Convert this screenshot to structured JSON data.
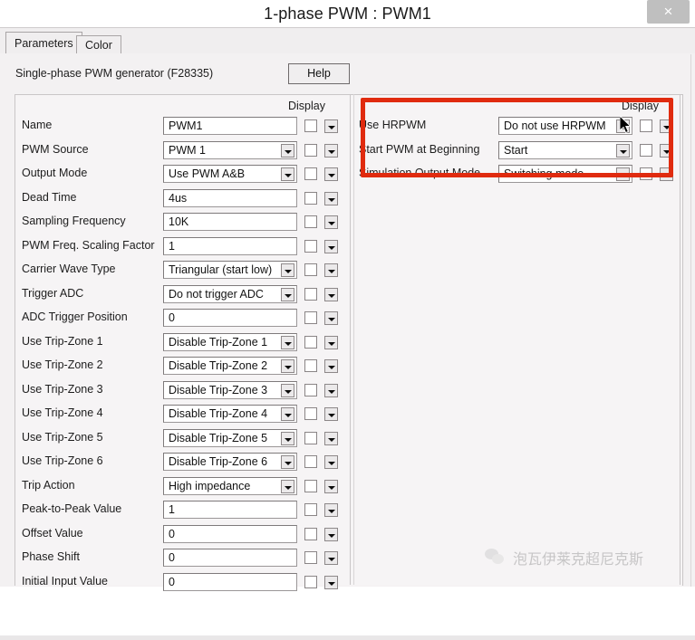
{
  "window": {
    "title": "1-phase PWM : PWM1",
    "close_label": "×"
  },
  "tabs": [
    {
      "label": "Parameters",
      "active": true
    },
    {
      "label": "Color",
      "active": false
    }
  ],
  "header": {
    "description": "Single-phase PWM generator (F28335)",
    "help_label": "Help"
  },
  "columns": {
    "left_display_header": "Display",
    "right_display_header": "Display"
  },
  "left_params": [
    {
      "label": "Name",
      "value": "PWM1",
      "type": "text"
    },
    {
      "label": "PWM Source",
      "value": "PWM 1",
      "type": "combo"
    },
    {
      "label": "Output Mode",
      "value": "Use PWM A&B",
      "type": "combo"
    },
    {
      "label": "Dead Time",
      "value": "4us",
      "type": "text"
    },
    {
      "label": "Sampling Frequency",
      "value": "10K",
      "type": "text"
    },
    {
      "label": "PWM Freq. Scaling Factor",
      "value": "1",
      "type": "text"
    },
    {
      "label": "Carrier Wave Type",
      "value": "Triangular (start low)",
      "type": "combo"
    },
    {
      "label": "Trigger ADC",
      "value": "Do not trigger ADC",
      "type": "combo"
    },
    {
      "label": "ADC Trigger Position",
      "value": "0",
      "type": "text"
    },
    {
      "label": "Use Trip-Zone 1",
      "value": "Disable Trip-Zone 1",
      "type": "combo"
    },
    {
      "label": "Use Trip-Zone 2",
      "value": "Disable Trip-Zone 2",
      "type": "combo"
    },
    {
      "label": "Use Trip-Zone 3",
      "value": "Disable Trip-Zone 3",
      "type": "combo"
    },
    {
      "label": "Use Trip-Zone 4",
      "value": "Disable Trip-Zone 4",
      "type": "combo"
    },
    {
      "label": "Use Trip-Zone 5",
      "value": "Disable Trip-Zone 5",
      "type": "combo"
    },
    {
      "label": "Use Trip-Zone 6",
      "value": "Disable Trip-Zone 6",
      "type": "combo"
    },
    {
      "label": "Trip Action",
      "value": "High impedance",
      "type": "combo"
    },
    {
      "label": "Peak-to-Peak Value",
      "value": "1",
      "type": "text"
    },
    {
      "label": "Offset Value",
      "value": "0",
      "type": "text"
    },
    {
      "label": "Phase Shift",
      "value": "0",
      "type": "text"
    },
    {
      "label": "Initial Input Value",
      "value": "0",
      "type": "text"
    }
  ],
  "right_params": [
    {
      "label": "Use HRPWM",
      "value": "Do not use HRPWM",
      "type": "combo"
    },
    {
      "label": "Start PWM at Beginning",
      "value": "Start",
      "type": "combo"
    },
    {
      "label": "Simulation Output Mode",
      "value": "Switching mode",
      "type": "combo"
    }
  ],
  "annotation": {
    "highlight_color": "#e02b0f"
  },
  "watermark": {
    "text": "泡瓦伊莱克超尼克斯"
  }
}
